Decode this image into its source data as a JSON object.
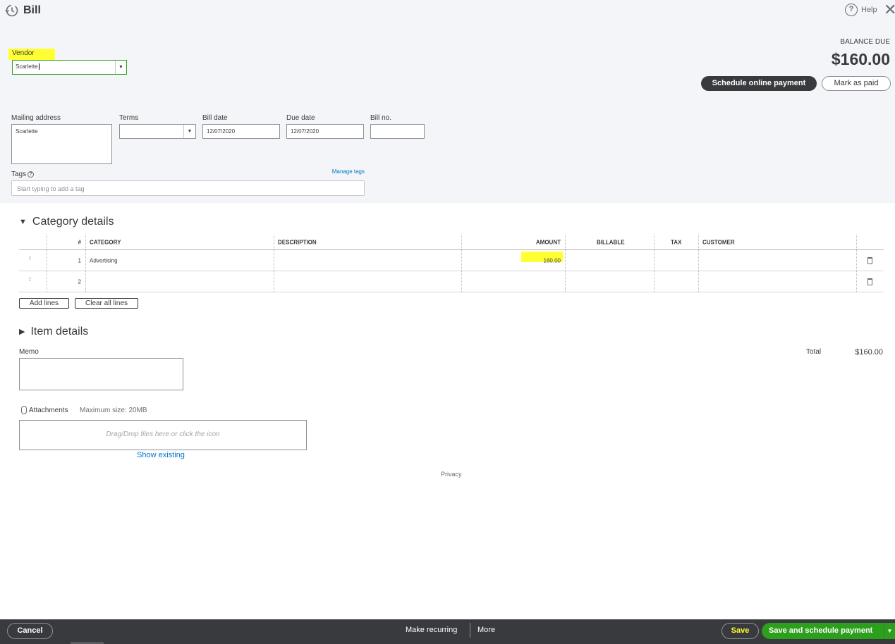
{
  "header": {
    "title": "Bill",
    "help_label": "Help",
    "close_glyph": "✕",
    "help_glyph": "?"
  },
  "vendor": {
    "label": "Vendor",
    "value": "Scarlette"
  },
  "balance": {
    "label": "BALANCE DUE",
    "amount": "$160.00",
    "schedule_label": "Schedule online payment",
    "mark_paid_label": "Mark as paid"
  },
  "fields": {
    "mailing_address": {
      "label": "Mailing address",
      "value": "Scarlette"
    },
    "terms": {
      "label": "Terms",
      "value": ""
    },
    "bill_date": {
      "label": "Bill date",
      "value": "12/07/2020"
    },
    "due_date": {
      "label": "Due date",
      "value": "12/07/2020"
    },
    "bill_no": {
      "label": "Bill no.",
      "value": ""
    }
  },
  "tags": {
    "label": "Tags",
    "manage_label": "Manage tags",
    "placeholder": "Start typing to add a tag"
  },
  "category_details": {
    "title": "Category details",
    "columns": [
      "#",
      "CATEGORY",
      "DESCRIPTION",
      "AMOUNT",
      "BILLABLE",
      "TAX",
      "CUSTOMER"
    ],
    "rows": [
      {
        "num": "1",
        "category": "Advertising",
        "description": "",
        "amount": "160.00",
        "billable": "",
        "tax": "",
        "customer": ""
      },
      {
        "num": "2",
        "category": "",
        "description": "",
        "amount": "",
        "billable": "",
        "tax": "",
        "customer": ""
      }
    ],
    "add_lines_label": "Add lines",
    "clear_lines_label": "Clear all lines"
  },
  "item_details": {
    "title": "Item details"
  },
  "memo": {
    "label": "Memo",
    "value": ""
  },
  "total": {
    "label": "Total",
    "value": "$160.00"
  },
  "attachments": {
    "label": "Attachments",
    "max_size": "Maximum size: 20MB",
    "drop_text": "Drag/Drop files here or click the icon",
    "show_existing": "Show existing"
  },
  "privacy": "Privacy",
  "footer": {
    "cancel": "Cancel",
    "make_recurring": "Make recurring",
    "more": "More",
    "save": "Save",
    "save_schedule": "Save and schedule payment"
  },
  "colors": {
    "highlight": "#ffff33",
    "brand_green": "#2ca01c",
    "dark": "#393a3d",
    "link": "#0077c5"
  }
}
